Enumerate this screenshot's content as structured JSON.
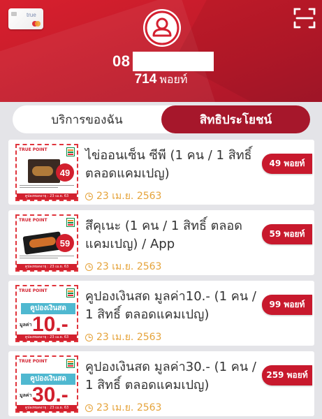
{
  "header": {
    "card_brand": "true",
    "phone_prefix": "08",
    "points_value": "714",
    "points_unit": "พอยท์"
  },
  "tabs": [
    {
      "label": "บริการของฉัน",
      "active": false
    },
    {
      "label": "สิทธิประโยชน์",
      "active": true
    }
  ],
  "items": [
    {
      "title": "ไข่ออนเซ็น ซีพี (1 คน / 1 สิทธิ์ ตลอดแคมเปญ)",
      "date": "23 เม.ย. 2563",
      "badge": "49 พอยท์",
      "coupon": {
        "price": "49",
        "footer": "คูปองหมดอายุ : 23 เม.ย. 63",
        "tag": "TRUE POINT"
      }
    },
    {
      "title": "สึคุเนะ (1 คน / 1 สิทธิ์ ตลอดแคมเปญ) / App",
      "date": "23 เม.ย. 2563",
      "badge": "59 พอยท์",
      "coupon": {
        "price": "59",
        "footer": "คูปองหมดอายุ : 23 เม.ย. 63",
        "tag": "TRUE POINT"
      }
    },
    {
      "title": "คูปองเงินสด มูลค่า10.- (1 คน / 1 สิทธิ์ ตลอดแคมเปญ)",
      "date": "23 เม.ย. 2563",
      "badge": "99 พอยท์",
      "coupon": {
        "label": "คูปองเงินสด",
        "prefix": "มูลค่า",
        "amount": "10.-",
        "footer": "คูปองหมดอายุ : 23 เม.ย. 63",
        "tag": "TRUE POINT"
      }
    },
    {
      "title": "คูปองเงินสด มูลค่า30.- (1 คน / 1 สิทธิ์ ตลอดแคมเปญ)",
      "date": "23 เม.ย. 2563",
      "badge": "259 พอยท์",
      "coupon": {
        "label": "คูปองเงินสด",
        "prefix": "มูลค่า",
        "amount": "30.-",
        "footer": "คูปองหมดอายุ : 23 เม.ย. 63",
        "tag": "TRUE POINT"
      }
    }
  ],
  "icons": {
    "avatar": "user-icon",
    "scan": "scan-icon",
    "date": "clock-icon"
  },
  "colors": {
    "header_red": "#c01a2a",
    "active_tab": "#a6172b",
    "badge": "#c8192d",
    "date_text": "#e5a33a"
  }
}
